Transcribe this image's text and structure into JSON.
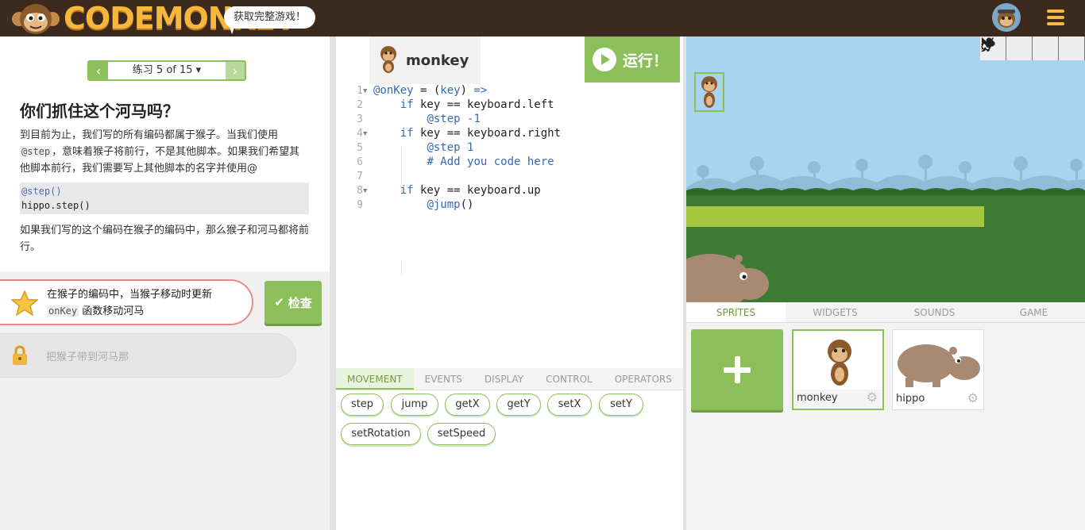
{
  "header": {
    "logo_text": "CODEMONKEY",
    "promo_bubble": "获取完整游戏！"
  },
  "instructions": {
    "pager_label": "练习 5 of 15 ▾",
    "title": "你们抓住这个河马吗？",
    "para1_a": "到目前为止，我们写的所有编码都属于猴子。当我们使用",
    "para1_code": "@step",
    "para1_b": "，意味着猴子将前行，不是其他脚本。如果我们希望其他脚本前行，我们需要写上其他脚本的名字并使用@",
    "code_line1": "@step()",
    "code_line2": "hippo.step()",
    "para2": "如果我们写的这个编码在猴子的编码中，那么猴子和河马都将前行。"
  },
  "challenge": {
    "text_a": "在猴子的编码中，当猴子移动时更新",
    "code": "onKey",
    "text_b": "函数移动河马",
    "check_label": "检查",
    "locked_text": "把猴子带到河马那"
  },
  "editor": {
    "sprite_name": "monkey",
    "run_label": "运行！",
    "lines": [
      "@onKey = (key) =>",
      "    if key == keyboard.left",
      "        @step -1",
      "    if key == keyboard.right",
      "        @step 1",
      "        # Add you code here",
      "",
      "    if key == keyboard.up",
      "        @jump()"
    ],
    "palette_tabs": [
      "MOVEMENT",
      "EVENTS",
      "DISPLAY",
      "CONTROL",
      "OPERATORS"
    ],
    "blocks": [
      "step",
      "jump",
      "getX",
      "getY",
      "setX",
      "setY",
      "setRotation",
      "setSpeed"
    ]
  },
  "stage": {
    "tools": [
      "pointer-icon",
      "move-icon",
      "eraser-icon",
      "brush-icon"
    ]
  },
  "sprites_panel": {
    "tabs": [
      "SPRITES",
      "WIDGETS",
      "SOUNDS",
      "GAME"
    ],
    "sprites": [
      "monkey",
      "hippo"
    ]
  },
  "colors": {
    "accent_green": "#8cbf5a",
    "header_brown": "#3b2a1d",
    "logo_orange": "#f6b73c",
    "challenge_border": "#e98a8a"
  }
}
